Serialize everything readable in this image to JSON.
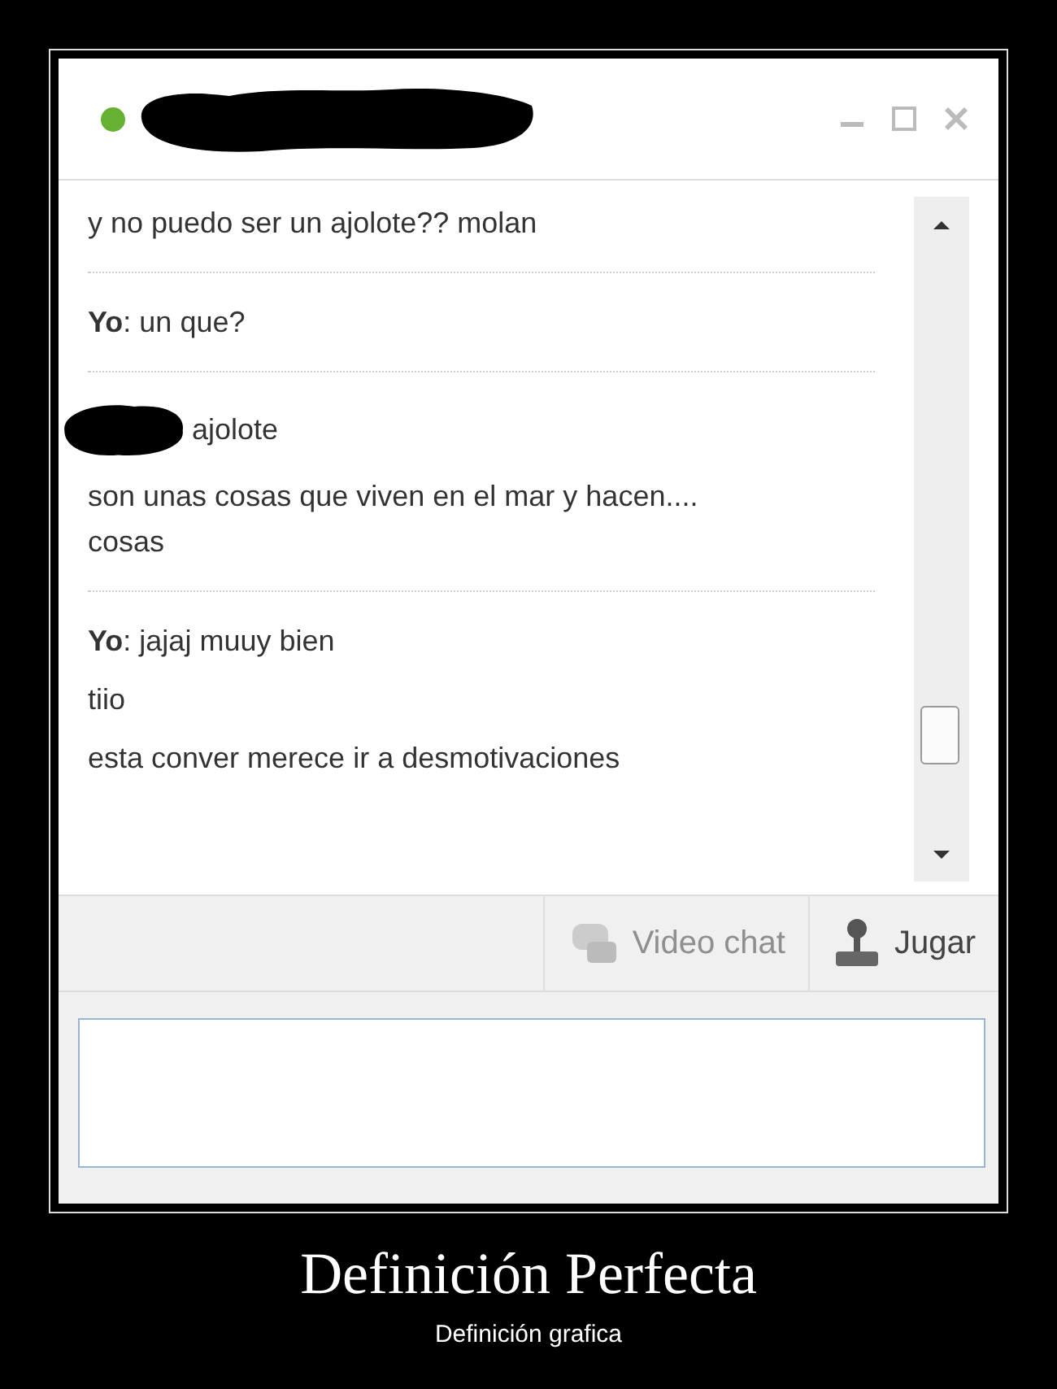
{
  "window": {
    "online": true,
    "title_redacted": true
  },
  "messages": [
    {
      "redacted_sender": false,
      "lines": [
        "y no puedo ser un ajolote?? molan"
      ]
    },
    {
      "redacted_sender": false,
      "lines": [
        "**Yo**: un que?"
      ]
    },
    {
      "redacted_sender": true,
      "lines": [
        "ajolote",
        "son unas cosas que viven en el mar y hacen.... cosas"
      ]
    },
    {
      "redacted_sender": false,
      "lines": [
        "**Yo**: jajaj muuy bien",
        "tiio",
        "esta conver merece ir a desmotivaciones"
      ]
    }
  ],
  "toolbar": [
    {
      "kind": "video",
      "label": "Video chat",
      "disabled": true
    },
    {
      "kind": "game",
      "label": "Jugar",
      "disabled": false
    }
  ],
  "caption": {
    "title": "Definición Perfecta",
    "subtitle": "Definición grafica"
  }
}
